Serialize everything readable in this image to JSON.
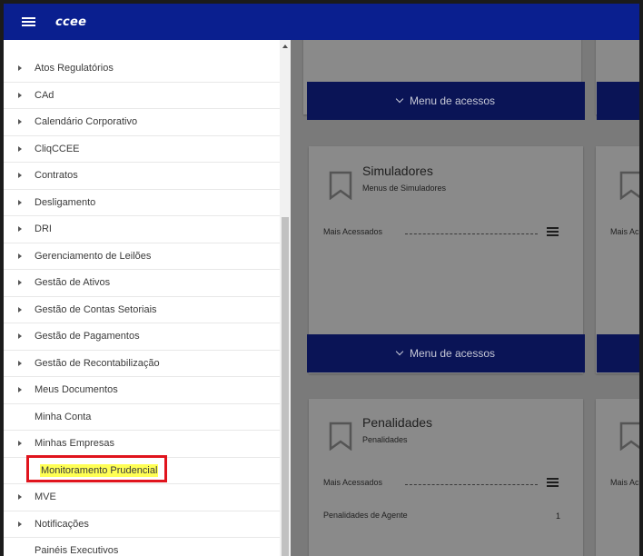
{
  "app": {
    "brand": "ccee"
  },
  "sidebar": {
    "items": [
      {
        "label": "Atos Regulatórios",
        "expandable": true
      },
      {
        "label": "CAd",
        "expandable": true
      },
      {
        "label": "Calendário Corporativo",
        "expandable": true
      },
      {
        "label": "CliqCCEE",
        "expandable": true
      },
      {
        "label": "Contratos",
        "expandable": true
      },
      {
        "label": "Desligamento",
        "expandable": true
      },
      {
        "label": "DRI",
        "expandable": true
      },
      {
        "label": "Gerenciamento de Leilões",
        "expandable": true
      },
      {
        "label": "Gestão de Ativos",
        "expandable": true
      },
      {
        "label": "Gestão de Contas Setoriais",
        "expandable": true
      },
      {
        "label": "Gestão de Pagamentos",
        "expandable": true
      },
      {
        "label": "Gestão de Recontabilização",
        "expandable": true
      },
      {
        "label": "Meus Documentos",
        "expandable": true
      },
      {
        "label": "Minha Conta",
        "expandable": false
      },
      {
        "label": "Minhas Empresas",
        "expandable": true
      },
      {
        "label": "Monitoramento Prudencial",
        "expandable": false,
        "highlighted": true
      },
      {
        "label": "MVE",
        "expandable": true
      },
      {
        "label": "Notificações",
        "expandable": true
      },
      {
        "label": "Painéis Executivos",
        "expandable": false
      }
    ]
  },
  "cards": {
    "menu_btn_label": "Menu de acessos",
    "simuladores": {
      "title": "Simuladores",
      "subtitle": "Menus de Simuladores",
      "mais": "Mais Acessados"
    },
    "penalidades": {
      "title": "Penalidades",
      "subtitle": "Penalidades",
      "mais": "Mais Acessados",
      "row_label": "Penalidades de Agente",
      "row_count": "1"
    },
    "right_mais_1": "Mais Ac",
    "right_mais_2": "Mais Ac"
  },
  "colors": {
    "topbar": "#0a1f8f",
    "button": "#0a1456",
    "highlight": "#e0141d",
    "marker": "#ffff55"
  }
}
